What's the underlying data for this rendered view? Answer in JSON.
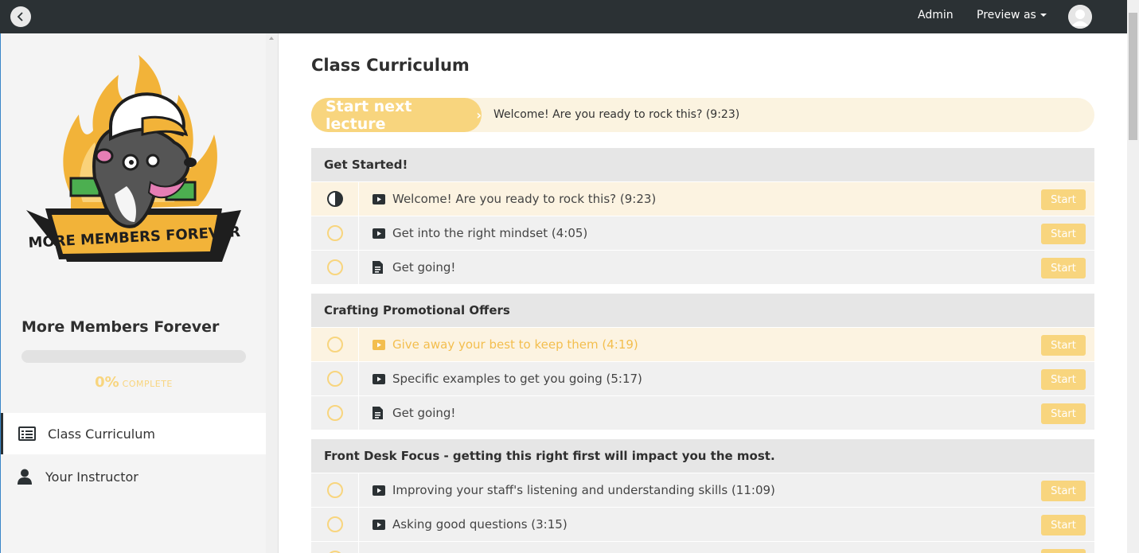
{
  "topbar": {
    "admin_label": "Admin",
    "preview_label": "Preview as"
  },
  "sidebar": {
    "logo_text": "MORE MEMBERS FOREVER",
    "course_title": "More Members Forever",
    "progress_percent": "0%",
    "progress_value": 0,
    "progress_label": "COMPLETE",
    "nav": [
      {
        "label": "Class Curriculum",
        "icon": "list-icon",
        "active": true
      },
      {
        "label": "Your Instructor",
        "icon": "user-icon",
        "active": false
      }
    ]
  },
  "main": {
    "title": "Class Curriculum",
    "next_button_label": "Start next lecture",
    "next_lecture_text": "Welcome! Are you ready to rock this? (9:23)",
    "start_label": "Start",
    "sections": [
      {
        "title": "Get Started!",
        "lectures": [
          {
            "title": "Welcome! Are you ready to rock this? (9:23)",
            "type": "video",
            "status": "in-progress"
          },
          {
            "title": "Get into the right mindset (4:05)",
            "type": "video",
            "status": "not-started"
          },
          {
            "title": "Get going!",
            "type": "document",
            "status": "not-started"
          }
        ]
      },
      {
        "title": "Crafting Promotional Offers",
        "lectures": [
          {
            "title": "Give away your best to keep them (4:19)",
            "type": "video",
            "status": "not-started"
          },
          {
            "title": "Specific examples to get you going (5:17)",
            "type": "video",
            "status": "not-started"
          },
          {
            "title": "Get going!",
            "type": "document",
            "status": "not-started"
          }
        ]
      },
      {
        "title": "Front Desk Focus - getting this right first will impact you the most.",
        "lectures": [
          {
            "title": "Improving your staff's listening and understanding skills (11:09)",
            "type": "video",
            "status": "not-started"
          },
          {
            "title": "Asking good questions (3:15)",
            "type": "video",
            "status": "not-started"
          },
          {
            "title": "",
            "type": "video",
            "status": "not-started"
          }
        ]
      }
    ]
  },
  "colors": {
    "accent": "#f8d57e",
    "topbar": "#2b3134",
    "highlight_row": "#fcf3e1"
  }
}
